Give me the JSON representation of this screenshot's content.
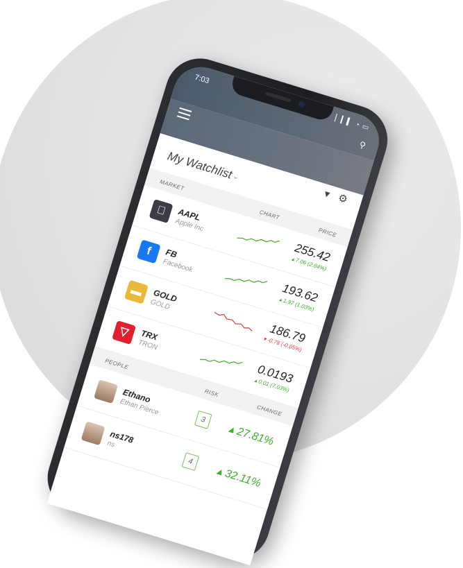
{
  "status": {
    "time": "7:03",
    "icons": "▏▎▍ ◔ ▭"
  },
  "watchlist": {
    "title": "My Watchlist"
  },
  "market": {
    "headers": {
      "market": "MARKET",
      "chart": "CHART",
      "price": "PRICE"
    },
    "rows": [
      {
        "symbol": "AAPL",
        "name": "Apple Inc",
        "price": "255.42",
        "change": "▴ 7.06 (2.84%)",
        "direction": "up",
        "logo": "",
        "logo_color": "#3c3c44"
      },
      {
        "symbol": "FB",
        "name": "Facebook",
        "price": "193.62",
        "change": "▴ 1.97 (1.03%)",
        "direction": "up",
        "logo": "f",
        "logo_color": "#1877f2"
      },
      {
        "symbol": "GOLD",
        "name": "GOLD",
        "price": "186.79",
        "change": "▾ -0.78 (-0.05%)",
        "direction": "down",
        "logo": "▬",
        "logo_color": "#e9b93b"
      },
      {
        "symbol": "TRX",
        "name": "TRON",
        "price": "0.0193",
        "change": "▴ 0.01 (7.03%)",
        "direction": "up",
        "logo": "▽",
        "logo_color": "#e0202e"
      }
    ]
  },
  "people": {
    "headers": {
      "people": "PEOPLE",
      "risk": "RISK",
      "change": "CHANGE"
    },
    "rows": [
      {
        "username": "Ethano",
        "fullname": "Ethan Pierce",
        "risk": "3",
        "change": "▴ 27.81%"
      },
      {
        "username": "ns178",
        "fullname": "ns",
        "risk": "4",
        "change": "▴ 32.11%"
      }
    ]
  },
  "colors": {
    "up": "#3fae29",
    "down": "#e03a3a",
    "risk_border": "#7cc04e"
  }
}
